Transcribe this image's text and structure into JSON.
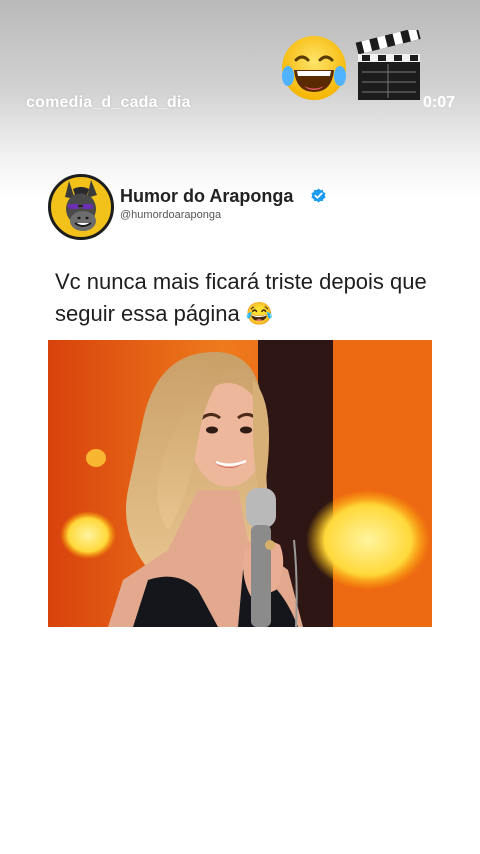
{
  "story": {
    "username": "comedia_d_cada_dia",
    "time": "0:07",
    "stickers": [
      "laughing-tears-emoji",
      "clapperboard-icon"
    ]
  },
  "post": {
    "display_name": "Humor do Araponga",
    "handle": "@humordoaraponga",
    "verified": true,
    "text": "Vc nunca mais ficará triste depois que seguir essa página 😂"
  },
  "colors": {
    "verified_blue": "#1d9bf0",
    "avatar_yellow": "#f3c21a",
    "stage_orange": "#e45d12"
  }
}
